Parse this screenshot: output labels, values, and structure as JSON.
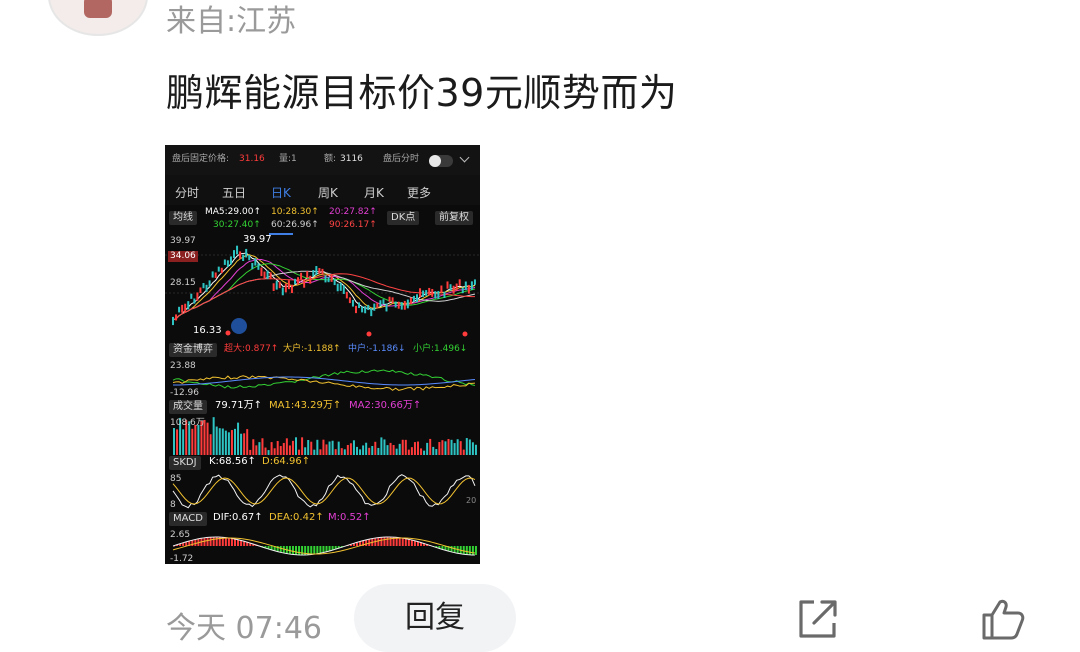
{
  "post": {
    "source": "来自:江苏",
    "text": "鹏辉能源目标价39元顺势而为",
    "time": "今天 07:46",
    "reply_label": "回复"
  },
  "icons": {
    "share": "share-icon",
    "like": "thumbs-up-icon"
  },
  "screenshot": {
    "header": {
      "price_label": "盘后固定价格:",
      "price_value": "31.16",
      "volume_label": "量:1",
      "amount_label": "额:",
      "amount_value": "3116",
      "after_hours_label": "盘后分时"
    },
    "tabs": [
      "分时",
      "五日",
      "日K",
      "周K",
      "月K",
      "更多"
    ],
    "active_tab": "日K",
    "ma": {
      "selector": "均线",
      "ma5": "MA5:29.00↑",
      "ma10": "10:28.30↑",
      "ma20": "20:27.82↑",
      "ma30": "30:27.40↑",
      "ma60": "60:26.96↑",
      "ma90": "90:26.17↑",
      "dk_button": "DK点",
      "adjust_button": "前复权"
    },
    "price_axis": {
      "high": "39.97",
      "mid": "28.15",
      "marker_high": "34.06",
      "low_marker": "16.33",
      "high_marker": "39.97"
    },
    "fund_flow": {
      "selector": "资金博弈",
      "super": "超大:0.877↑",
      "large": "大户:-1.188↑",
      "medium": "中户:-1.186↓",
      "small": "小户:1.496↓",
      "axis_top": "23.88",
      "axis_bottom": "-12.96"
    },
    "volume": {
      "selector": "成交量",
      "value": "79.71万↑",
      "ma1": "MA1:43.29万↑",
      "ma2": "MA2:30.66万↑",
      "axis": "108.6万"
    },
    "skdj": {
      "selector": "SKDJ",
      "k": "K:68.56↑",
      "d": "D:64.96↑",
      "axis_top": "85",
      "axis_bottom": "8",
      "axis_right": "20"
    },
    "macd": {
      "selector": "MACD",
      "dif": "DIF:0.67↑",
      "dea": "DEA:0.42↑",
      "m": "M:0.52↑",
      "axis_top": "2.65",
      "axis_bottom": "-1.72"
    },
    "colors": {
      "up": "#ff3b3b",
      "down": "#2ec4c4",
      "ma5": "#ffffff",
      "ma10": "#f2c230",
      "ma20": "#e23fd3",
      "ma30": "#33d133",
      "ma60": "#d0d0d0",
      "ma90": "#ff4444"
    }
  }
}
